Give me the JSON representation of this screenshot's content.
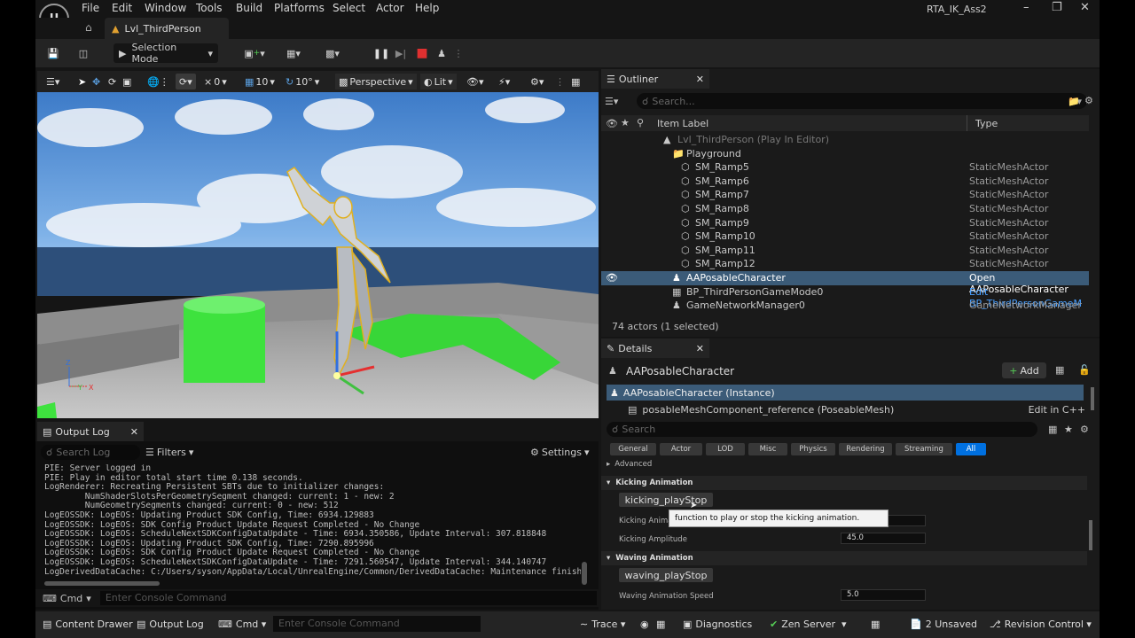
{
  "app": {
    "project_name": "RTA_IK_Ass2",
    "logo_letter": "U"
  },
  "menu": [
    "File",
    "Edit",
    "Window",
    "Tools",
    "Build",
    "Platforms",
    "Select",
    "Actor",
    "Help"
  ],
  "tab": {
    "title": "Lvl_ThirdPerson"
  },
  "toolbar": {
    "selection_mode": "Selection Mode"
  },
  "viewport": {
    "perspective": "Perspective",
    "lit": "Lit",
    "grid_snap": "10",
    "rot_snap": "10°",
    "cam_speed": "0",
    "axis": [
      "Z",
      "Y",
      "X"
    ]
  },
  "output_log": {
    "tab_label": "Output Log",
    "search_placeholder": "Search Log",
    "filters_label": "Filters",
    "settings_label": "Settings",
    "cmd_label": "Cmd",
    "console_placeholder": "Enter Console Command",
    "lines": [
      "PIE: Server logged in",
      "PIE: Play in editor total start time 0.138 seconds.",
      "LogRenderer: Recreating Persistent SBTs due to initializer changes:",
      "        NumShaderSlotsPerGeometrySegment changed: current: 1 - new: 2",
      "        NumGeometrySegments changed: current: 0 - new: 512",
      "LogEOSSDK: LogEOS: Updating Product SDK Config, Time: 6934.129883",
      "LogEOSSDK: LogEOS: SDK Config Product Update Request Completed - No Change",
      "LogEOSSDK: LogEOS: ScheduleNextSDKConfigDataUpdate - Time: 6934.350586, Update Interval: 307.818848",
      "LogEOSSDK: LogEOS: Updating Product SDK Config, Time: 7290.895996",
      "LogEOSSDK: LogEOS: SDK Config Product Update Request Completed - No Change",
      "LogEOSSDK: LogEOS: ScheduleNextSDKConfigDataUpdate - Time: 7291.560547, Update Interval: 344.140747",
      "LogDerivedDataCache: C:/Users/syson/AppData/Local/UnrealEngine/Common/DerivedDataCache: Maintenance finishe"
    ]
  },
  "outliner": {
    "title": "Outliner",
    "search_placeholder": "Search...",
    "col_label": "Item Label",
    "col_type": "Type",
    "rows": [
      {
        "label": "Lvl_ThirdPerson (Play In Editor)",
        "type": "",
        "indent": 1,
        "icon": "level-icon",
        "dim": true
      },
      {
        "label": "Playground",
        "type": "",
        "indent": 2,
        "icon": "folder-icon"
      },
      {
        "label": "SM_Ramp5",
        "type": "StaticMeshActor",
        "indent": 3,
        "icon": "mesh-icon"
      },
      {
        "label": "SM_Ramp6",
        "type": "StaticMeshActor",
        "indent": 3,
        "icon": "mesh-icon"
      },
      {
        "label": "SM_Ramp7",
        "type": "StaticMeshActor",
        "indent": 3,
        "icon": "mesh-icon"
      },
      {
        "label": "SM_Ramp8",
        "type": "StaticMeshActor",
        "indent": 3,
        "icon": "mesh-icon"
      },
      {
        "label": "SM_Ramp9",
        "type": "StaticMeshActor",
        "indent": 3,
        "icon": "mesh-icon"
      },
      {
        "label": "SM_Ramp10",
        "type": "StaticMeshActor",
        "indent": 3,
        "icon": "mesh-icon"
      },
      {
        "label": "SM_Ramp11",
        "type": "StaticMeshActor",
        "indent": 3,
        "icon": "mesh-icon"
      },
      {
        "label": "SM_Ramp12",
        "type": "StaticMeshActor",
        "indent": 3,
        "icon": "mesh-icon"
      },
      {
        "label": "AAPosableCharacter",
        "type": "Open AAPosableCharacter",
        "indent": 2,
        "icon": "pawn-icon",
        "selected": true
      },
      {
        "label": "BP_ThirdPersonGameMode0",
        "type": "Edit BP_ThirdPersonGameM",
        "indent": 2,
        "icon": "blueprint-icon",
        "link": true
      },
      {
        "label": "GameNetworkManager0",
        "type": "GameNetworkManager",
        "indent": 2,
        "icon": "actor-icon"
      }
    ],
    "footer": "74 actors (1 selected)"
  },
  "details": {
    "title": "Details",
    "actor_name": "AAPosableCharacter",
    "add_label": "Add",
    "instance_label": "AAPosableCharacter (Instance)",
    "component_label": "posableMeshComponent_reference (PoseableMesh)",
    "edit_cpp": "Edit in C++",
    "search_placeholder": "Search",
    "filters": [
      "General",
      "Actor",
      "LOD",
      "Misc",
      "Physics",
      "Rendering",
      "Streaming",
      "All"
    ],
    "advanced_label": "Advanced",
    "kicking_category": "Kicking Animation",
    "kicking_button": "kicking_playStop",
    "tooltip": "function to play or stop the kicking animation.",
    "kicking_speed_label": "Kicking Animation Speed",
    "kicking_amp_label": "Kicking Amplitude",
    "kicking_amp_value": "45.0",
    "waving_category": "Waving Animation",
    "waving_button": "waving_playStop",
    "waving_speed_label": "Waving Animation Speed",
    "waving_speed_value": "5.0"
  },
  "statusbar": {
    "content_drawer": "Content Drawer",
    "output_log": "Output Log",
    "cmd": "Cmd",
    "console_placeholder": "Enter Console Command",
    "trace": "Trace",
    "diagnostics": "Diagnostics",
    "zen_server": "Zen Server",
    "unsaved": "2 Unsaved",
    "revision": "Revision Control"
  },
  "colors": {
    "accent": "#0070e0",
    "selected_row": "#3b5b78",
    "green_mesh": "#3ee23e"
  }
}
